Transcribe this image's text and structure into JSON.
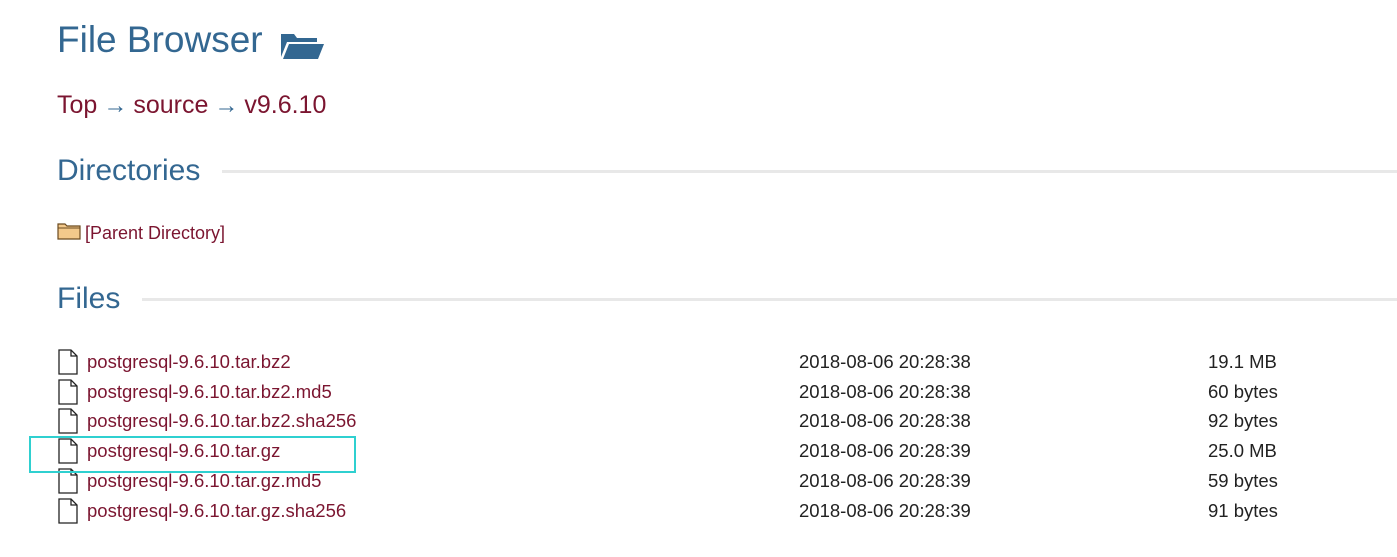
{
  "header": {
    "title": "File Browser",
    "title_icon": "folder-open-icon"
  },
  "breadcrumb": {
    "items": [
      "Top",
      "source",
      "v9.6.10"
    ],
    "separator": "→"
  },
  "directories": {
    "heading": "Directories",
    "parent_label": "[Parent Directory]",
    "parent_icon": "folder-icon"
  },
  "files": {
    "heading": "Files",
    "rows": [
      {
        "name": "postgresql-9.6.10.tar.bz2",
        "date": "2018-08-06 20:28:38",
        "size": "19.1 MB"
      },
      {
        "name": "postgresql-9.6.10.tar.bz2.md5",
        "date": "2018-08-06 20:28:38",
        "size": "60 bytes"
      },
      {
        "name": "postgresql-9.6.10.tar.bz2.sha256",
        "date": "2018-08-06 20:28:38",
        "size": "92 bytes"
      },
      {
        "name": "postgresql-9.6.10.tar.gz",
        "date": "2018-08-06 20:28:39",
        "size": "25.0 MB"
      },
      {
        "name": "postgresql-9.6.10.tar.gz.md5",
        "date": "2018-08-06 20:28:39",
        "size": "59 bytes"
      },
      {
        "name": "postgresql-9.6.10.tar.gz.sha256",
        "date": "2018-08-06 20:28:39",
        "size": "91 bytes"
      }
    ]
  },
  "colors": {
    "heading": "#336791",
    "link": "#7b1530",
    "highlight": "#2fd0d0"
  }
}
